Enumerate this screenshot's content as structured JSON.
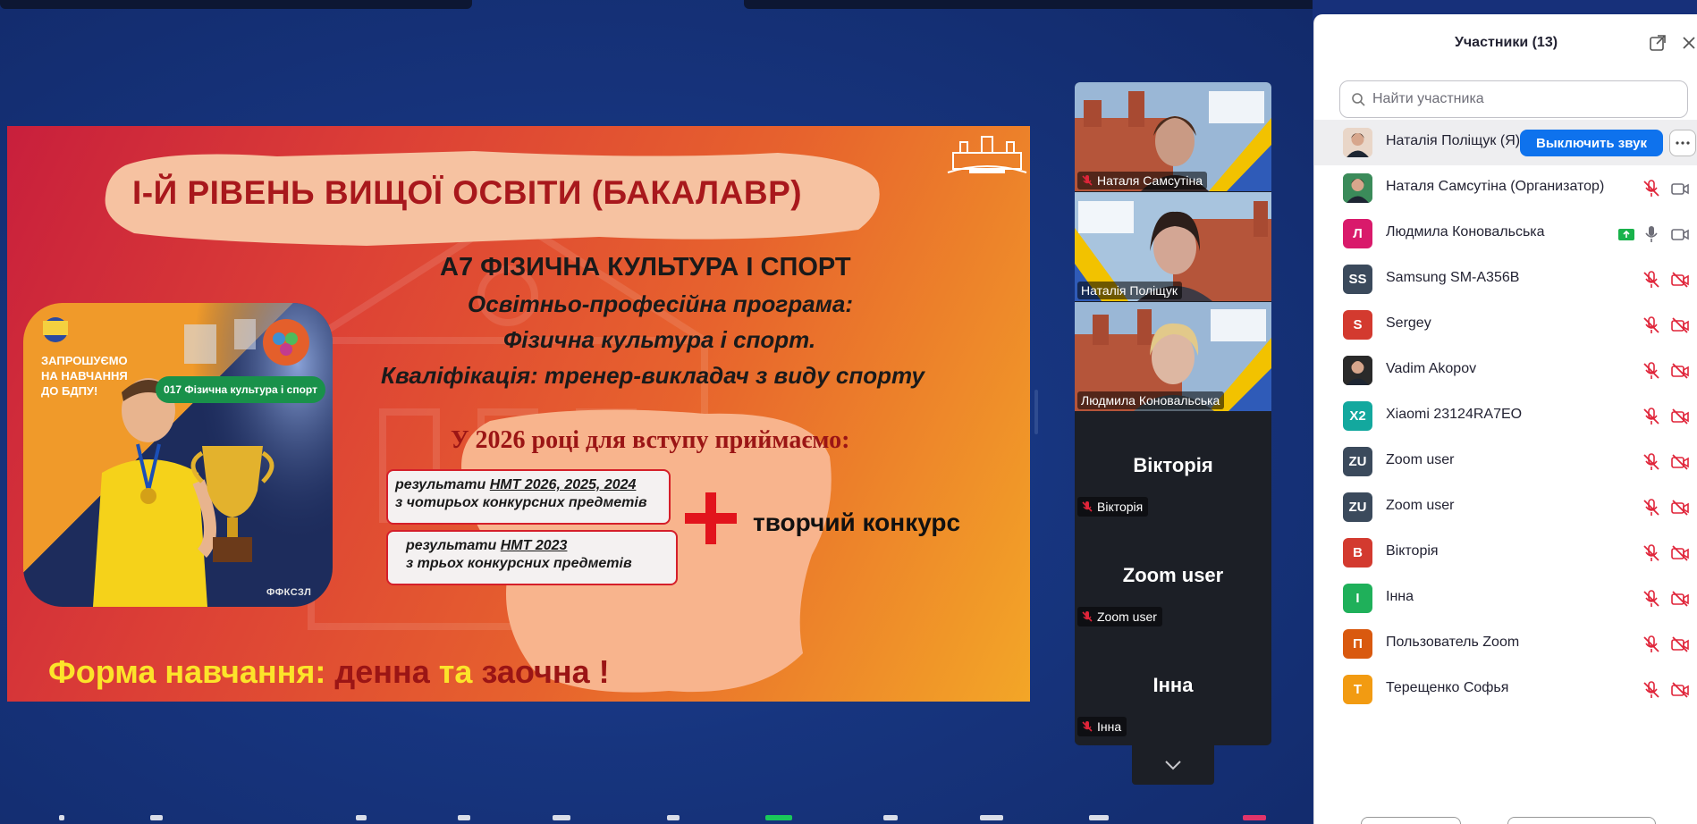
{
  "slide": {
    "title": "І-Й РІВЕНЬ ВИЩОЇ ОСВІТИ (БАКАЛАВР)",
    "specialty": "А7 ФІЗИЧНА КУЛЬТУРА І СПОРТ",
    "program_label": "Освітньо-професійна програма:",
    "program_name": "Фізична культура і спорт.",
    "qualification": "Кваліфікація: тренер-викладач з виду спорту",
    "admission_heading": "У 2026 році для вступу приймаємо:",
    "box1_prefix": "результати ",
    "box1_link": "НМТ 2026, 2025, 2024",
    "box1_suffix": "з чотирьох конкурсних предметів",
    "box2_prefix": "результати ",
    "box2_link": "НМТ 2023 ",
    "box2_suffix": "з трьох конкурсних предметів",
    "creative_contest": "творчий конкурс",
    "form_label": "Форма навчання:",
    "form_day": "денна",
    "form_and": "та",
    "form_extramural": "заочна !"
  },
  "poster": {
    "invite": [
      "ЗАПРОШУЄМО",
      "НА НАВЧАННЯ",
      "ДО БДПУ!"
    ],
    "program_pill": "017 Фізична культура і спорт",
    "tag": "ФФКСЗЛ"
  },
  "gallery": {
    "video_tiles": [
      {
        "name": "Наталя Самсутіна",
        "muted": true
      },
      {
        "name": "Наталія Поліщук",
        "muted": false
      },
      {
        "name": "Людмила Коновальська",
        "muted": false,
        "active": true
      }
    ],
    "name_tiles": [
      {
        "display": "Вікторія",
        "label": "Вікторія"
      },
      {
        "display": "Zoom user",
        "label": "Zoom user"
      },
      {
        "display": "Інна",
        "label": "Інна"
      }
    ]
  },
  "panel": {
    "title": "Участники (13)",
    "search_placeholder": "Найти участника",
    "mute_button": "Выключить звук",
    "participants": [
      {
        "name": "Наталія Поліщук (Я)",
        "initials": "",
        "color": "#e9d6c8",
        "photo": true,
        "self": true
      },
      {
        "name": "Наталя Самсутіна (Организатор)",
        "initials": "",
        "color": "#3b8b5a",
        "photo": true,
        "mic": "off",
        "cam": "on"
      },
      {
        "name": "Людмила Коновальська",
        "initials": "Л",
        "color": "#d91a6b",
        "mic": "on",
        "cam": "on",
        "share": true
      },
      {
        "name": "Samsung SM-A356B",
        "initials": "SS",
        "color": "#3b4a5c",
        "mic": "off",
        "cam": "off"
      },
      {
        "name": "Sergey",
        "initials": "S",
        "color": "#d33a2f",
        "mic": "off",
        "cam": "off"
      },
      {
        "name": "Vadim Akopov",
        "initials": "",
        "color": "#2a2a2a",
        "photo": true,
        "mic": "off",
        "cam": "off"
      },
      {
        "name": "Xiaomi 23124RA7EO",
        "initials": "X2",
        "color": "#13a89e",
        "mic": "off",
        "cam": "off"
      },
      {
        "name": "Zoom user",
        "initials": "ZU",
        "color": "#3b4a5c",
        "mic": "off",
        "cam": "off"
      },
      {
        "name": "Zoom user",
        "initials": "ZU",
        "color": "#3b4a5c",
        "mic": "off",
        "cam": "off"
      },
      {
        "name": "Вікторія",
        "initials": "В",
        "color": "#d33a2f",
        "mic": "off",
        "cam": "off"
      },
      {
        "name": "Інна",
        "initials": "І",
        "color": "#1fb05a",
        "mic": "off",
        "cam": "off"
      },
      {
        "name": "Пользователь Zoom",
        "initials": "П",
        "color": "#d9590f",
        "mic": "off",
        "cam": "off"
      },
      {
        "name": "Терещенко Софья",
        "initials": "Т",
        "color": "#f29b12",
        "mic": "off",
        "cam": "off"
      }
    ]
  },
  "colors": {
    "accent_blue": "#0e72ed",
    "mute_red": "#e0253a",
    "active_speaker": "#26d967",
    "slide_title_red": "#a8181c"
  },
  "icons": [
    "popout-icon",
    "close-icon",
    "search-icon",
    "mic-off-icon",
    "mic-on-icon",
    "video-on-icon",
    "video-off-icon",
    "share-screen-icon",
    "more-icon",
    "chevron-down-icon"
  ]
}
